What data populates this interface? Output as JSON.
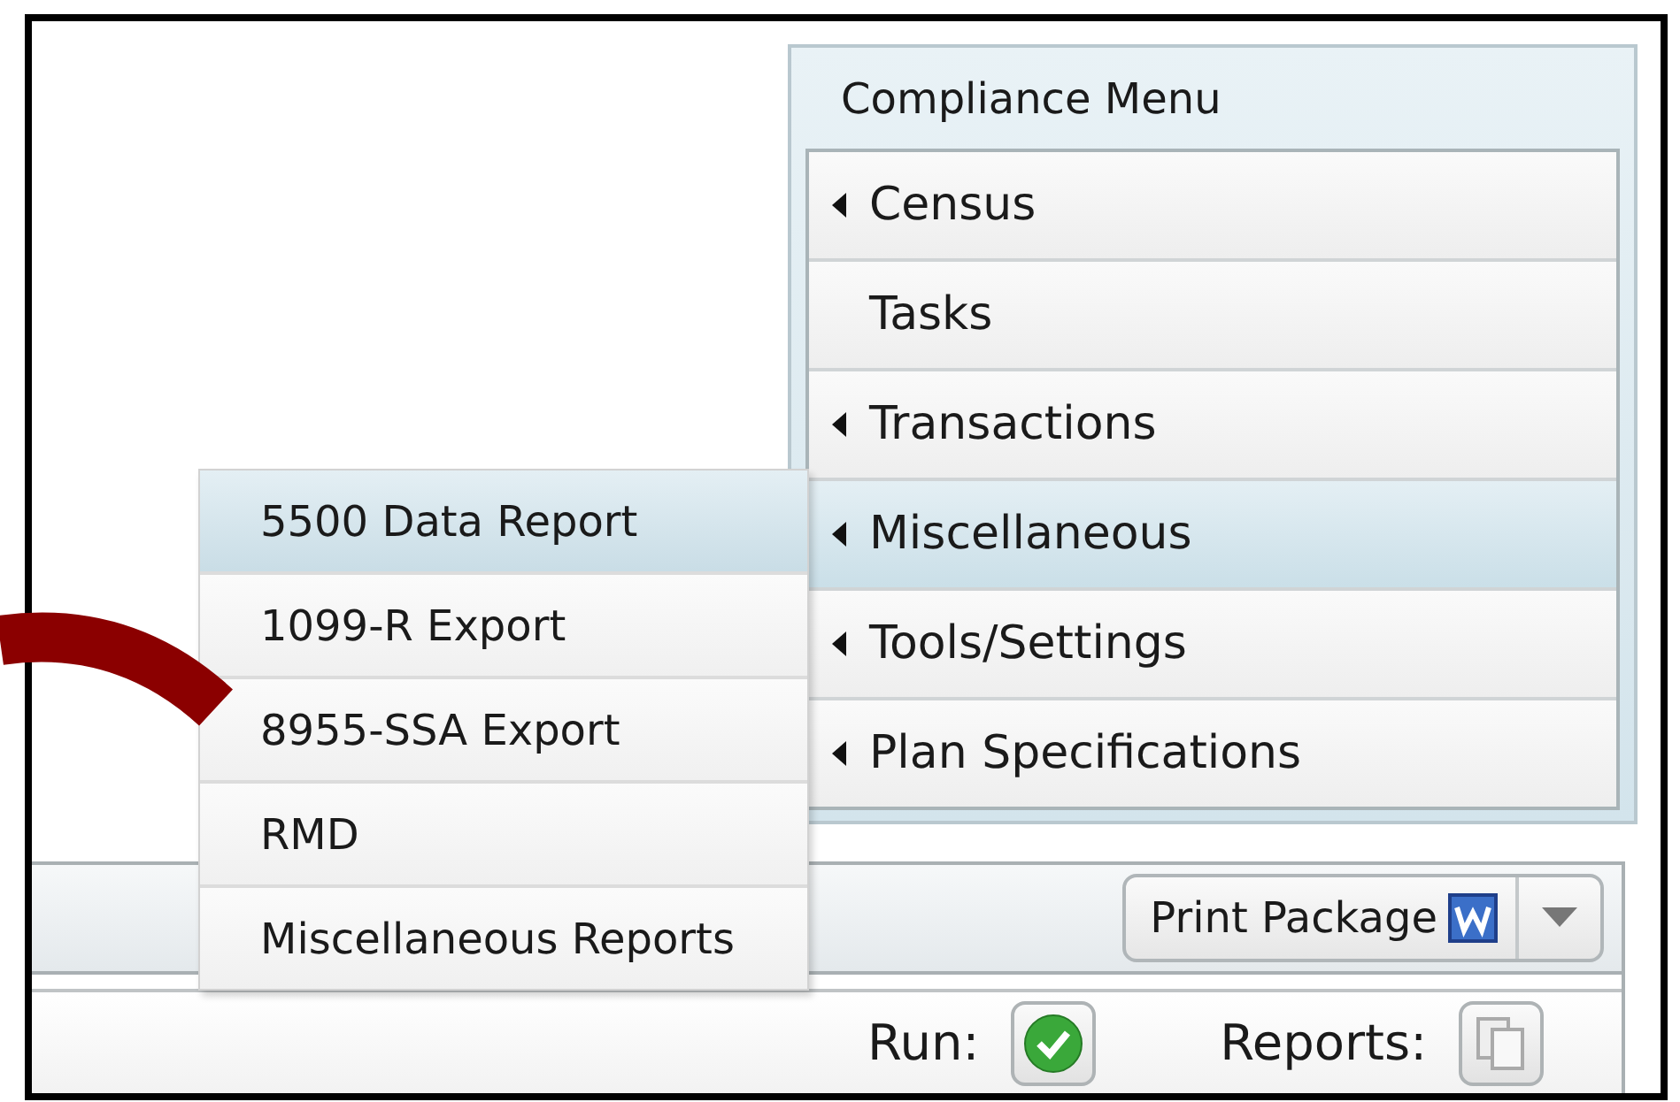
{
  "menu": {
    "title": "Compliance Menu",
    "items": [
      {
        "label": "Census",
        "has_submenu": true,
        "selected": false
      },
      {
        "label": "Tasks",
        "has_submenu": false,
        "selected": false
      },
      {
        "label": "Transactions",
        "has_submenu": true,
        "selected": false
      },
      {
        "label": "Miscellaneous",
        "has_submenu": true,
        "selected": true
      },
      {
        "label": "Tools/Settings",
        "has_submenu": true,
        "selected": false
      },
      {
        "label": "Plan Specifications",
        "has_submenu": true,
        "selected": false
      }
    ]
  },
  "submenu": {
    "items": [
      {
        "label": "5500 Data Report",
        "selected": true
      },
      {
        "label": "1099-R Export",
        "selected": false
      },
      {
        "label": "8955-SSA Export",
        "selected": false
      },
      {
        "label": "RMD",
        "selected": false
      },
      {
        "label": "Miscellaneous Reports",
        "selected": false
      }
    ]
  },
  "toolbar": {
    "print_button": {
      "label": "Print Package"
    }
  },
  "run": {
    "label": "Run:"
  },
  "reports": {
    "label": "Reports:"
  }
}
